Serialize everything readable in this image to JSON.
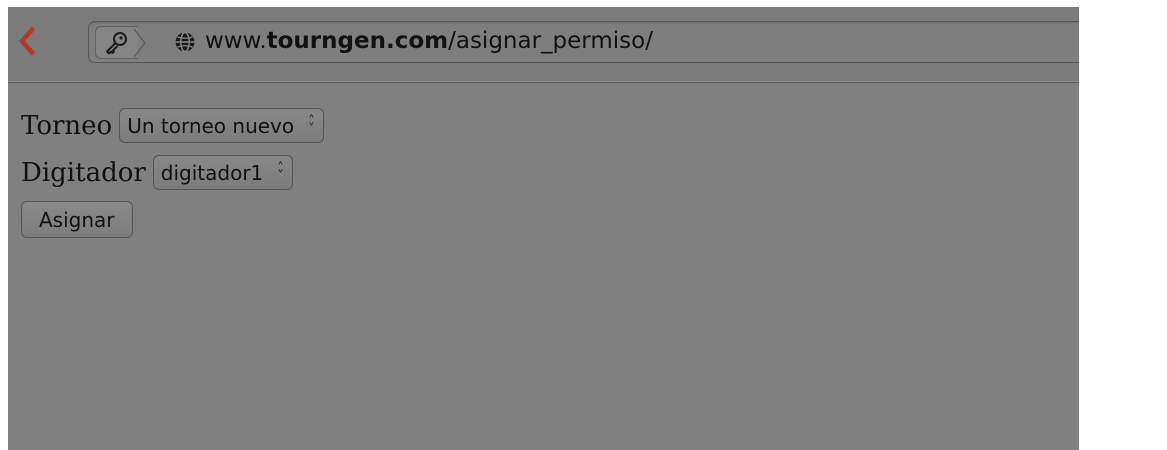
{
  "browser": {
    "url_prefix": "www.",
    "url_domain": "tourngen.com",
    "url_path": "/asignar_permiso/"
  },
  "form": {
    "torneo_label": "Torneo",
    "torneo_selected": "Un torneo nuevo",
    "digitador_label": "Digitador",
    "digitador_selected": "digitador1",
    "submit_label": "Asignar"
  },
  "colors": {
    "back_arrow": "#b23a2a",
    "page_background": "#808080"
  },
  "icons": {
    "back": "back-arrow-icon",
    "identity": "key-icon",
    "site": "globe-icon",
    "select": "up-down-arrows-icon"
  }
}
